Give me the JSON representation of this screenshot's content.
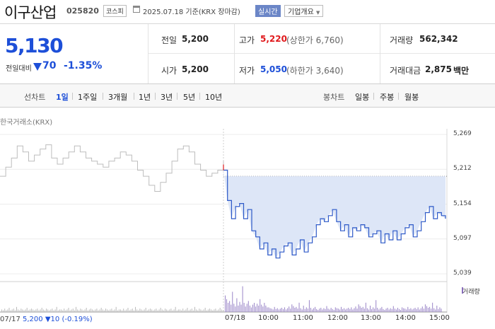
{
  "header": {
    "name": "이구산업",
    "code": "025820",
    "market": "코스피",
    "date_text": "2025.07.18 기준(KRX 장마감)",
    "realtime_label": "실시간",
    "company_info_label": "기업개요"
  },
  "summary": {
    "price": "5,130",
    "change_label": "전일대비",
    "change_value": "70",
    "change_pct": "-1.35%",
    "prev_close_label": "전일",
    "prev_close": "5,200",
    "open_label": "시가",
    "open": "5,200",
    "high_label": "고가",
    "high": "5,220",
    "upper_limit": "(상한가 6,760)",
    "low_label": "저가",
    "low": "5,050",
    "lower_limit": "(하한가 3,640)",
    "volume_label": "거래량",
    "volume": "562,342",
    "amount_label": "거래대금",
    "amount": "2,875",
    "amount_unit": "백만"
  },
  "toolbar": {
    "line_label": "선차트",
    "line_periods": [
      "1일",
      "1주일",
      "3개월",
      "1년",
      "3년",
      "5년",
      "10년"
    ],
    "candle_label": "봉차트",
    "candle_periods": [
      "일봉",
      "주봉",
      "월봉"
    ]
  },
  "chart": {
    "source": "한국거래소(KRX)",
    "volume_label": "거래량",
    "footer": {
      "date": "07/17",
      "price": "5,200",
      "change": "▼10",
      "pct": "(-0.19%)"
    }
  },
  "chart_data": {
    "type": "line",
    "yticks": [
      "5,269",
      "5,212",
      "5,154",
      "5,097",
      "5,039"
    ],
    "ylim": [
      5039,
      5269
    ],
    "prev_close": 5200,
    "xticks": [
      "07/18",
      "10:00",
      "11:00",
      "12:00",
      "13:00",
      "14:00",
      "15:00"
    ],
    "series": [
      {
        "values": [
          5200,
          5215,
          5230,
          5250,
          5240,
          5225,
          5235,
          5245,
          5252,
          5230,
          5220,
          5230,
          5240,
          5250,
          5240,
          5230,
          5225,
          5220,
          5215,
          5225,
          5230,
          5240,
          5235,
          5225,
          5210,
          5200,
          5185,
          5175,
          5190,
          5205,
          5225,
          5245,
          5250,
          5240,
          5220,
          5210,
          5200,
          5205,
          5210,
          5225
        ],
        "color": "#bdbdbd"
      },
      {
        "values": [
          5210,
          5160,
          5130,
          5150,
          5155,
          5130,
          5145,
          5110,
          5100,
          5080,
          5090,
          5070,
          5080,
          5065,
          5075,
          5085,
          5090,
          5070,
          5080,
          5095,
          5075,
          5090,
          5100,
          5120,
          5130,
          5125,
          5135,
          5145,
          5125,
          5110,
          5120,
          5100,
          5115,
          5110,
          5120,
          5115,
          5100,
          5105,
          5110,
          5090,
          5105,
          5095,
          5110,
          5095,
          5105,
          5115,
          5120,
          5100,
          5110,
          5125,
          5140,
          5150,
          5130,
          5140,
          5135,
          5130
        ],
        "color": "#2d59c8"
      }
    ],
    "grid": true
  }
}
